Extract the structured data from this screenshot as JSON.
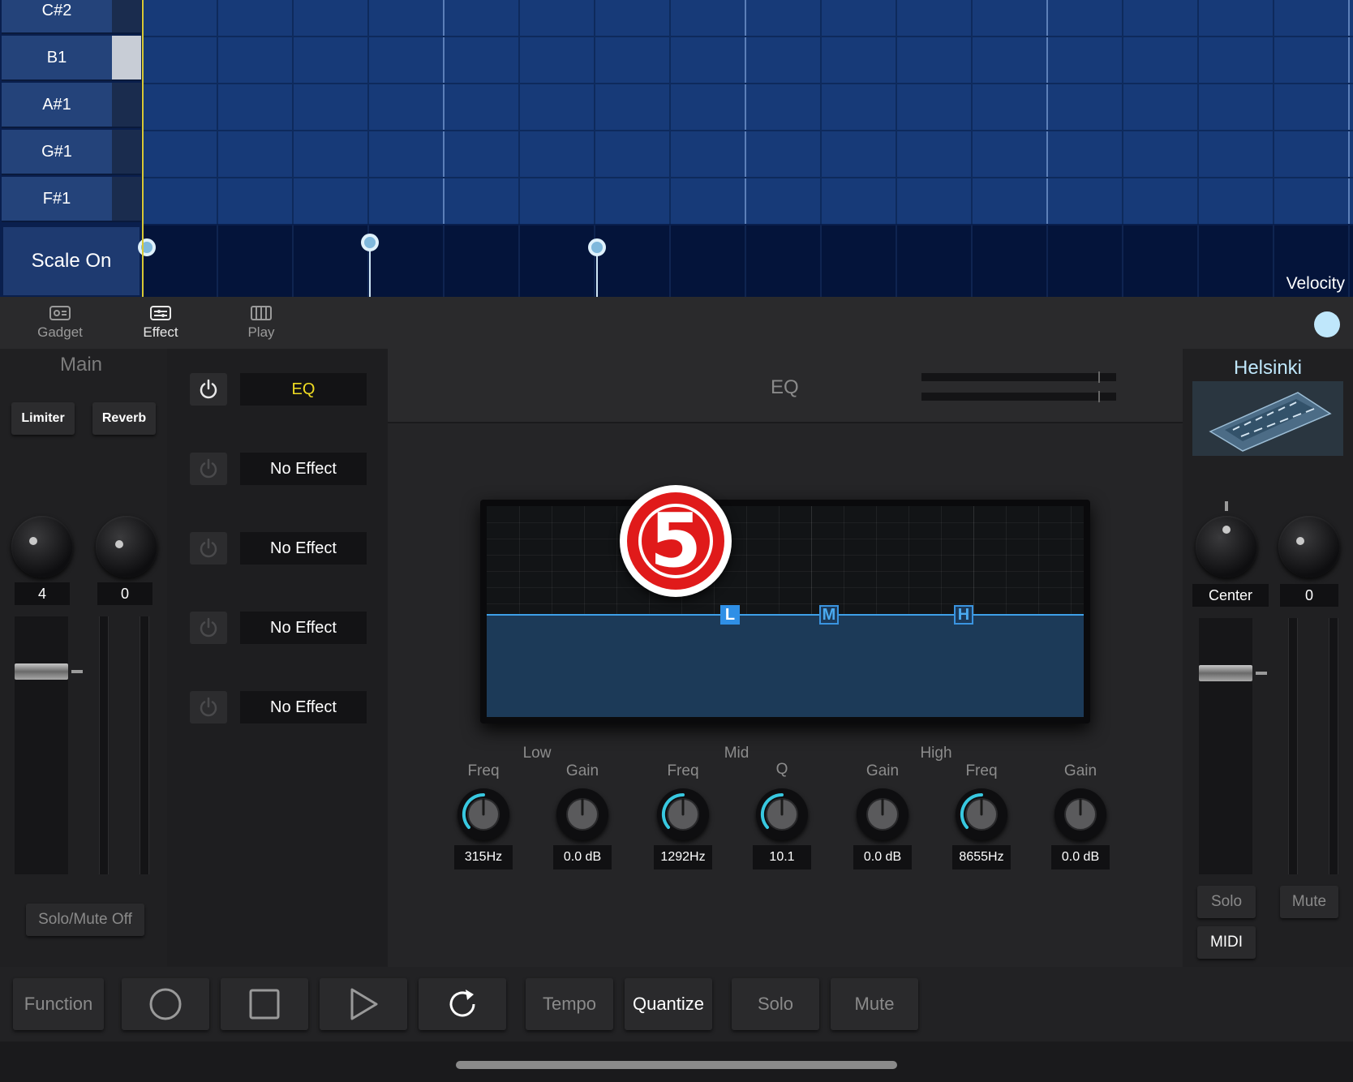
{
  "piano_roll": {
    "keys": [
      "C#2",
      "B1",
      "A#1",
      "G#1",
      "F#1"
    ],
    "scale_button": "Scale On",
    "velocity_label": "Velocity"
  },
  "tabs": [
    {
      "label": "Gadget",
      "icon": "gadget-icon"
    },
    {
      "label": "Effect",
      "icon": "effect-icon"
    },
    {
      "label": "Play",
      "icon": "keyboard-icon"
    }
  ],
  "active_tab": "Effect",
  "main": {
    "title": "Main",
    "buttons": [
      "Limiter",
      "Reverb"
    ],
    "knob_values": [
      "4",
      "0"
    ],
    "solo_mute": "Solo/Mute Off"
  },
  "effects": {
    "slots": [
      "EQ",
      "No Effect",
      "No Effect",
      "No Effect",
      "No Effect"
    ]
  },
  "eq": {
    "title": "EQ",
    "badge": "5",
    "bands": [
      "L",
      "M",
      "H"
    ],
    "groups": [
      "Low",
      "Mid",
      "High"
    ],
    "controls": [
      {
        "label": "Freq",
        "value": "315Hz"
      },
      {
        "label": "Gain",
        "value": "0.0 dB"
      },
      {
        "label": "Freq",
        "value": "1292Hz"
      },
      {
        "label": "Q",
        "value": "10.1"
      },
      {
        "label": "Gain",
        "value": "0.0 dB"
      },
      {
        "label": "Freq",
        "value": "8655Hz"
      },
      {
        "label": "Gain",
        "value": "0.0 dB"
      }
    ]
  },
  "gadget": {
    "name": "Helsinki",
    "pan_value": "Center",
    "level_value": "0",
    "solo": "Solo",
    "mute": "Mute",
    "midi": "MIDI"
  },
  "transport": {
    "function": "Function",
    "tempo": "Tempo",
    "quantize": "Quantize",
    "solo": "Solo",
    "mute": "Mute"
  },
  "colors": {
    "grid": "#173a78",
    "accent": "#3ea0e8",
    "slot_active": "#f0dc22",
    "badge": "#e01a1a",
    "gadget_title": "#bfe7fb"
  }
}
